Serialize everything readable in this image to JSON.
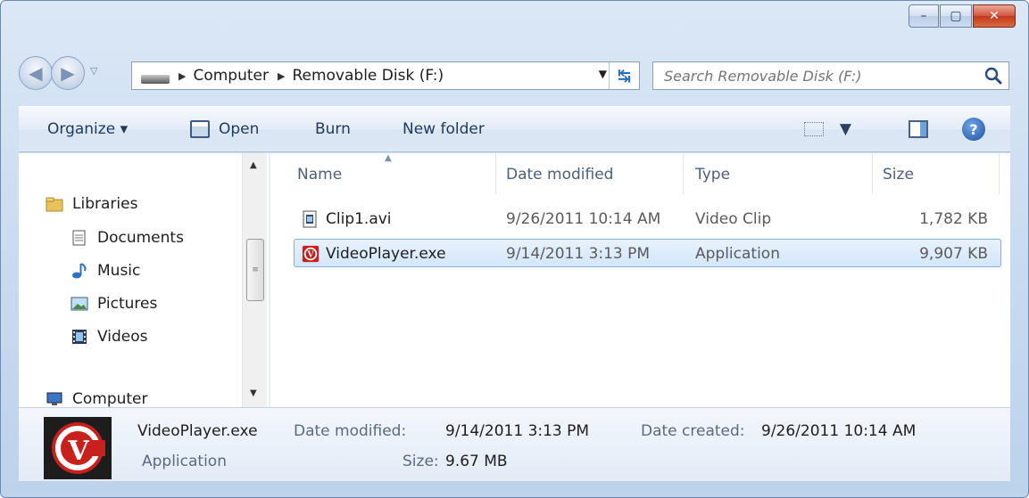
{
  "window": {
    "caption_buttons": {
      "minimize": "–",
      "maximize": "▢",
      "close": "✕"
    }
  },
  "address_bar": {
    "breadcrumbs": [
      "Computer",
      "Removable Disk (F:)"
    ],
    "search_placeholder": "Search Removable Disk (F:)"
  },
  "toolbar": {
    "organize": "Organize ▾",
    "open": "Open",
    "burn": "Burn",
    "new_folder": "New folder"
  },
  "nav_pane": {
    "items": [
      {
        "label": "Libraries",
        "icon": "libraries-icon"
      },
      {
        "label": "Documents",
        "icon": "documents-icon"
      },
      {
        "label": "Music",
        "icon": "music-icon"
      },
      {
        "label": "Pictures",
        "icon": "pictures-icon"
      },
      {
        "label": "Videos",
        "icon": "videos-icon"
      },
      {
        "label": "Computer",
        "icon": "computer-icon"
      }
    ]
  },
  "file_list": {
    "columns": [
      "Name",
      "Date modified",
      "Type",
      "Size"
    ],
    "rows": [
      {
        "name": "Clip1.avi",
        "date": "9/26/2011 10:14 AM",
        "type": "Video Clip",
        "size": "1,782 KB",
        "icon": "video-file-icon",
        "selected": false
      },
      {
        "name": "VideoPlayer.exe",
        "date": "9/14/2011 3:13 PM",
        "type": "Application",
        "size": "9,907 KB",
        "icon": "app-exe-icon",
        "selected": true
      }
    ]
  },
  "details_pane": {
    "filename": "VideoPlayer.exe",
    "file_type": "Application",
    "date_modified_label": "Date modified:",
    "date_modified": "9/14/2011 3:13 PM",
    "size_label": "Size:",
    "size": "9.67 MB",
    "date_created_label": "Date created:",
    "date_created": "9/26/2011 10:14 AM"
  },
  "colors": {
    "selection_border": "#84acdd",
    "app_icon_red": "#c8201c",
    "link_blue": "#1e395b"
  }
}
